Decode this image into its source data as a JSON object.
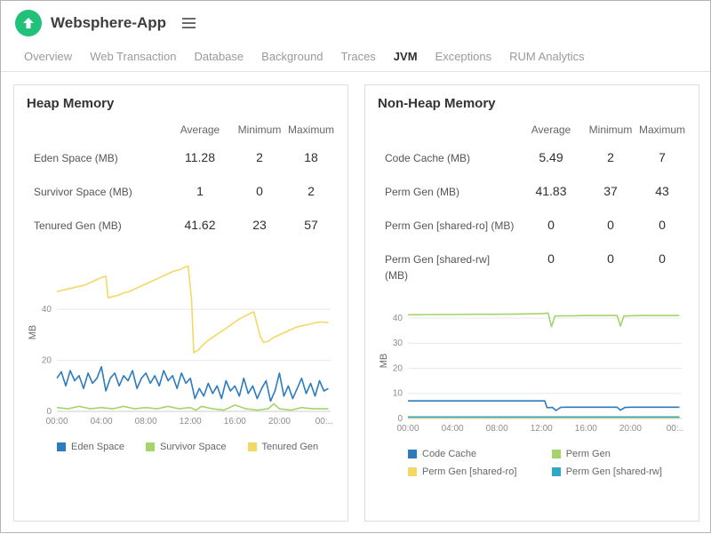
{
  "header": {
    "app_title": "Websphere-App",
    "accent_color": "#22c179"
  },
  "tabs": [
    {
      "label": "Overview",
      "active": false
    },
    {
      "label": "Web Transaction",
      "active": false
    },
    {
      "label": "Database",
      "active": false
    },
    {
      "label": "Background",
      "active": false
    },
    {
      "label": "Traces",
      "active": false
    },
    {
      "label": "JVM",
      "active": true
    },
    {
      "label": "Exceptions",
      "active": false
    },
    {
      "label": "RUM Analytics",
      "active": false
    }
  ],
  "panels": [
    {
      "title": "Heap Memory",
      "table": {
        "columns": [
          "Average",
          "Minimum",
          "Maximum"
        ],
        "rows": [
          {
            "label": "Eden Space (MB)",
            "values": [
              "11.28",
              "2",
              "18"
            ]
          },
          {
            "label": "Survivor Space (MB)",
            "values": [
              "1",
              "0",
              "2"
            ]
          },
          {
            "label": "Tenured Gen (MB)",
            "values": [
              "41.62",
              "23",
              "57"
            ]
          }
        ]
      },
      "chart_data": {
        "type": "line",
        "title": "Heap Memory",
        "ylabel": "MB",
        "xlabel": "",
        "xlim": [
          0,
          24.6
        ],
        "ylim": [
          0,
          62
        ],
        "y_ticks": [
          0,
          20,
          40
        ],
        "x_ticks": [
          0,
          4,
          8,
          12,
          16,
          20,
          24
        ],
        "x_tick_labels": [
          "00:00",
          "04:00",
          "08:00",
          "12:00",
          "16:00",
          "20:00",
          "00:.."
        ],
        "legend_position": "bottom",
        "grid": true,
        "series": [
          {
            "name": "Eden Space",
            "color": "#2e7bbd",
            "points": [
              [
                0,
                13
              ],
              [
                0.4,
                15.5
              ],
              [
                0.8,
                10
              ],
              [
                1.2,
                16
              ],
              [
                1.6,
                12
              ],
              [
                2,
                14
              ],
              [
                2.4,
                9
              ],
              [
                2.8,
                15
              ],
              [
                3.2,
                11
              ],
              [
                3.6,
                13
              ],
              [
                4,
                17.5
              ],
              [
                4.4,
                8
              ],
              [
                4.8,
                13
              ],
              [
                5.2,
                15
              ],
              [
                5.6,
                10
              ],
              [
                6,
                14
              ],
              [
                6.4,
                12
              ],
              [
                6.8,
                16
              ],
              [
                7.2,
                9
              ],
              [
                7.6,
                13
              ],
              [
                8,
                15
              ],
              [
                8.4,
                11
              ],
              [
                8.8,
                14
              ],
              [
                9.2,
                10
              ],
              [
                9.6,
                16
              ],
              [
                10,
                12
              ],
              [
                10.4,
                14
              ],
              [
                10.8,
                9
              ],
              [
                11.2,
                15
              ],
              [
                11.6,
                11
              ],
              [
                12,
                13
              ],
              [
                12.4,
                5
              ],
              [
                12.8,
                9
              ],
              [
                13.2,
                6
              ],
              [
                13.6,
                11
              ],
              [
                14,
                7
              ],
              [
                14.4,
                10
              ],
              [
                14.8,
                5
              ],
              [
                15.2,
                12
              ],
              [
                15.6,
                8
              ],
              [
                16,
                10
              ],
              [
                16.4,
                6
              ],
              [
                16.8,
                13
              ],
              [
                17.2,
                7
              ],
              [
                17.6,
                10
              ],
              [
                18,
                5
              ],
              [
                18.4,
                9
              ],
              [
                18.8,
                12
              ],
              [
                19.2,
                4
              ],
              [
                19.6,
                8
              ],
              [
                20,
                15
              ],
              [
                20.4,
                6
              ],
              [
                20.8,
                10
              ],
              [
                21.2,
                5
              ],
              [
                21.6,
                9
              ],
              [
                22,
                13
              ],
              [
                22.4,
                7
              ],
              [
                22.8,
                11
              ],
              [
                23.2,
                6
              ],
              [
                23.6,
                12
              ],
              [
                24,
                8
              ],
              [
                24.4,
                9
              ]
            ]
          },
          {
            "name": "Survivor Space",
            "color": "#a5d36c",
            "points": [
              [
                0,
                1.5
              ],
              [
                1,
                1
              ],
              [
                2,
                2
              ],
              [
                3,
                1
              ],
              [
                4,
                1.5
              ],
              [
                5,
                1
              ],
              [
                6,
                2
              ],
              [
                7,
                1
              ],
              [
                8,
                1.5
              ],
              [
                9,
                1
              ],
              [
                10,
                2
              ],
              [
                11,
                1
              ],
              [
                12,
                1.5
              ],
              [
                12.5,
                0.5
              ],
              [
                13,
                2
              ],
              [
                14,
                1
              ],
              [
                15,
                0.5
              ],
              [
                16,
                2.5
              ],
              [
                17,
                1
              ],
              [
                18,
                0.5
              ],
              [
                19,
                1
              ],
              [
                19.5,
                3
              ],
              [
                20,
                1
              ],
              [
                21,
                0.5
              ],
              [
                22,
                1.5
              ],
              [
                23,
                1
              ],
              [
                24,
                1
              ],
              [
                24.4,
                1
              ]
            ]
          },
          {
            "name": "Tenured Gen",
            "color": "#f3d963",
            "points": [
              [
                0,
                47
              ],
              [
                0.5,
                47.5
              ],
              [
                1,
                48
              ],
              [
                1.5,
                48.5
              ],
              [
                2,
                49
              ],
              [
                2.5,
                49.5
              ],
              [
                3,
                50.5
              ],
              [
                3.5,
                51.5
              ],
              [
                4,
                52.5
              ],
              [
                4.4,
                53
              ],
              [
                4.6,
                44.5
              ],
              [
                5,
                45
              ],
              [
                5.5,
                45.5
              ],
              [
                6,
                46.5
              ],
              [
                6.5,
                47
              ],
              [
                7,
                48
              ],
              [
                7.5,
                49
              ],
              [
                8,
                50
              ],
              [
                8.5,
                51
              ],
              [
                9,
                52
              ],
              [
                9.5,
                53
              ],
              [
                10,
                54
              ],
              [
                10.5,
                55
              ],
              [
                11,
                55.5
              ],
              [
                11.5,
                56.5
              ],
              [
                11.8,
                57
              ],
              [
                12.1,
                44
              ],
              [
                12.3,
                23
              ],
              [
                12.7,
                24
              ],
              [
                13,
                25.5
              ],
              [
                13.5,
                27.5
              ],
              [
                14,
                29
              ],
              [
                14.5,
                30.5
              ],
              [
                15,
                32
              ],
              [
                15.5,
                33.5
              ],
              [
                16,
                35
              ],
              [
                16.5,
                36.5
              ],
              [
                17,
                37.5
              ],
              [
                17.4,
                38.5
              ],
              [
                17.7,
                39
              ],
              [
                18,
                34
              ],
              [
                18.3,
                29
              ],
              [
                18.6,
                27
              ],
              [
                19,
                27.5
              ],
              [
                19.5,
                29
              ],
              [
                20,
                30
              ],
              [
                20.5,
                31
              ],
              [
                21,
                32
              ],
              [
                21.5,
                33
              ],
              [
                22,
                33.5
              ],
              [
                22.5,
                34
              ],
              [
                23,
                34.5
              ],
              [
                23.5,
                35
              ],
              [
                24,
                35
              ],
              [
                24.4,
                34.8
              ]
            ]
          }
        ]
      }
    },
    {
      "title": "Non-Heap Memory",
      "table": {
        "columns": [
          "Average",
          "Minimum",
          "Maximum"
        ],
        "rows": [
          {
            "label": "Code Cache (MB)",
            "values": [
              "5.49",
              "2",
              "7"
            ]
          },
          {
            "label": "Perm Gen (MB)",
            "values": [
              "41.83",
              "37",
              "43"
            ]
          },
          {
            "label": "Perm Gen [shared-ro] (MB)",
            "values": [
              "0",
              "0",
              "0"
            ]
          },
          {
            "label": "Perm Gen [shared-rw] (MB)",
            "values": [
              "0",
              "0",
              "0"
            ]
          }
        ]
      },
      "chart_data": {
        "type": "line",
        "title": "Non-Heap Memory",
        "ylabel": "MB",
        "xlabel": "",
        "xlim": [
          0,
          24.6
        ],
        "ylim": [
          0,
          46
        ],
        "y_ticks": [
          0,
          10,
          20,
          30,
          40
        ],
        "x_ticks": [
          0,
          4,
          8,
          12,
          16,
          20,
          24
        ],
        "x_tick_labels": [
          "00:00",
          "04:00",
          "08:00",
          "12:00",
          "16:00",
          "20:00",
          "00:.."
        ],
        "legend_position": "bottom",
        "grid": true,
        "series": [
          {
            "name": "Code Cache",
            "color": "#2e7bbd",
            "points": [
              [
                0,
                7
              ],
              [
                2,
                7
              ],
              [
                4,
                7
              ],
              [
                6,
                7
              ],
              [
                8,
                7
              ],
              [
                10,
                7
              ],
              [
                12,
                7
              ],
              [
                12.3,
                7
              ],
              [
                12.5,
                4.3
              ],
              [
                13,
                4.4
              ],
              [
                13.3,
                3.2
              ],
              [
                13.7,
                4.4
              ],
              [
                14,
                4.5
              ],
              [
                15,
                4.5
              ],
              [
                16,
                4.5
              ],
              [
                17,
                4.5
              ],
              [
                18,
                4.5
              ],
              [
                18.8,
                4.5
              ],
              [
                19.1,
                3.3
              ],
              [
                19.5,
                4.4
              ],
              [
                20,
                4.5
              ],
              [
                21,
                4.5
              ],
              [
                22,
                4.5
              ],
              [
                23,
                4.5
              ],
              [
                24,
                4.5
              ],
              [
                24.4,
                4.5
              ]
            ]
          },
          {
            "name": "Perm Gen",
            "color": "#a5d36c",
            "points": [
              [
                0,
                41.3
              ],
              [
                2,
                41.4
              ],
              [
                4,
                41.4
              ],
              [
                6,
                41.5
              ],
              [
                8,
                41.5
              ],
              [
                10,
                41.6
              ],
              [
                12,
                41.8
              ],
              [
                12.6,
                42
              ],
              [
                12.9,
                36.5
              ],
              [
                13.2,
                40.8
              ],
              [
                14,
                40.9
              ],
              [
                15,
                40.9
              ],
              [
                16,
                41
              ],
              [
                17,
                41
              ],
              [
                18,
                41
              ],
              [
                18.8,
                41
              ],
              [
                19.1,
                36.8
              ],
              [
                19.4,
                40.8
              ],
              [
                20,
                40.9
              ],
              [
                21,
                41
              ],
              [
                22,
                41
              ],
              [
                23,
                41
              ],
              [
                24,
                41
              ],
              [
                24.4,
                41
              ]
            ]
          },
          {
            "name": "Perm Gen [shared-ro]",
            "color": "#f3d963",
            "points": [
              [
                0,
                0.3
              ],
              [
                24.4,
                0.3
              ]
            ]
          },
          {
            "name": "Perm Gen [shared-rw]",
            "color": "#2fa7c7",
            "points": [
              [
                0,
                0.6
              ],
              [
                24.4,
                0.6
              ]
            ]
          }
        ]
      }
    }
  ]
}
